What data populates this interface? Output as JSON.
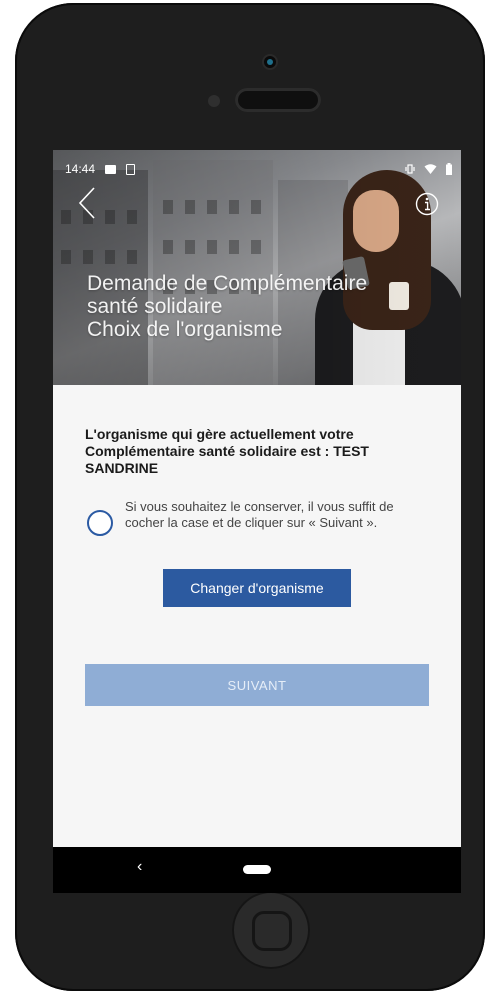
{
  "status_bar": {
    "time": "14:44",
    "left_icons": [
      "image-icon",
      "file-icon"
    ],
    "right_icons": [
      "vibrate-icon",
      "wifi-icon",
      "battery-icon"
    ]
  },
  "header": {
    "back_icon": "chevron-left-icon",
    "info_icon": "info-circle-icon",
    "title_lines": [
      "Demande de Complémentaire",
      "santé solidaire",
      "Choix de l'organisme"
    ]
  },
  "main": {
    "intro": "L'organisme qui gère actuellement votre Complémentaire santé solidaire est : TEST SANDRINE",
    "keep_option_text": "Si vous souhaitez le conserver, il vous suffit de cocher la case et de cliquer sur « Suivant ».",
    "keep_option_checked": false,
    "change_button_label": "Changer d'organisme",
    "next_button_label": "SUIVANT",
    "next_button_enabled": false
  },
  "android_nav": {
    "back_label": "‹",
    "home_icon": "home-pill-icon"
  },
  "colors": {
    "primary": "#2c5aa0",
    "disabled": "#8fadd5",
    "background": "#f6f6f6",
    "device": "#1e1e1e"
  }
}
